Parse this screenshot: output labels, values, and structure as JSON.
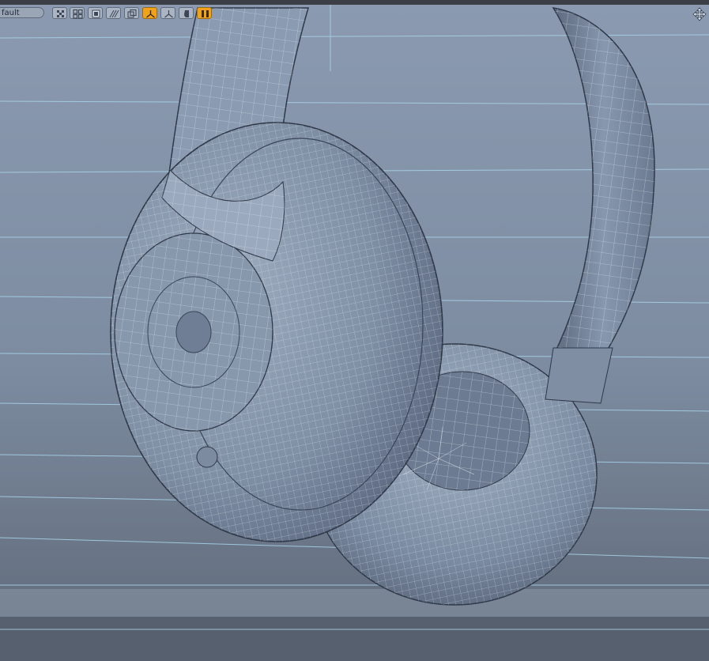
{
  "window": {
    "title": ""
  },
  "viewport_toolbar": {
    "preset_value": "fault",
    "buttons": [
      {
        "icon": "checker-shading-icon",
        "active": false
      },
      {
        "icon": "four-squares-icon",
        "active": false
      },
      {
        "icon": "solid-square-icon",
        "active": false
      },
      {
        "icon": "diagonal-hatch-icon",
        "active": false
      },
      {
        "icon": "copy-layers-icon",
        "active": false
      },
      {
        "icon": "axis-orange-icon",
        "active": true
      },
      {
        "icon": "axis-gray-icon",
        "active": false
      },
      {
        "icon": "half-shade-icon",
        "active": false
      },
      {
        "icon": "pause-bars-icon",
        "active": true
      }
    ],
    "nav_icon": "move-arrows-icon"
  },
  "colors": {
    "background_top": "#8b9ab0",
    "background_bottom": "#5e6979",
    "grid_line": "#a9d4ea",
    "mesh_fill": "#7e8ea3",
    "wire": "#e8eef5",
    "accent_orange": "#f0a21a"
  },
  "scene": {
    "object": "headphones",
    "display_mode": "wireframe-shaded"
  }
}
